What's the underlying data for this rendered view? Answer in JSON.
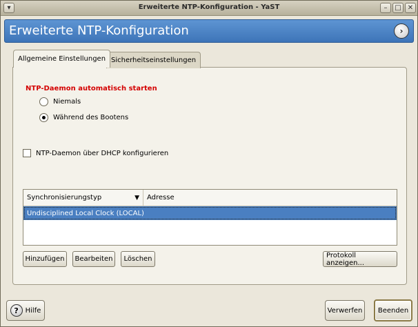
{
  "window": {
    "title": "Erweiterte NTP-Konfiguration - YaST",
    "controls": {
      "minimize": "–",
      "maximize": "□",
      "close": "✕"
    }
  },
  "header": {
    "title": "Erweiterte NTP-Konfiguration",
    "icon": "help-arrow-icon"
  },
  "tabs": [
    {
      "label": "Allgemeine Einstellungen",
      "active": true
    },
    {
      "label": "Sicherheitseinstellungen",
      "active": false
    }
  ],
  "start_section": {
    "label": "NTP-Daemon automatisch starten",
    "options": [
      {
        "label": "Niemals",
        "selected": false
      },
      {
        "label": "Während des Bootens",
        "selected": true
      }
    ]
  },
  "dhcp_checkbox": {
    "label": "NTP-Daemon über DHCP konfigurieren",
    "checked": false
  },
  "table": {
    "columns": [
      "Synchronisierungstyp",
      "Adresse"
    ],
    "sort_icon": "chevron-down-icon",
    "rows": [
      {
        "type": "Undisciplined Local Clock (LOCAL)",
        "address": "",
        "selected": true
      }
    ]
  },
  "table_buttons": {
    "add": "Hinzufügen",
    "edit": "Bearbeiten",
    "delete": "Löschen",
    "log": "Protokoll anzeigen..."
  },
  "footer": {
    "help": "Hilfe",
    "discard": "Verwerfen",
    "finish": "Beenden"
  },
  "colors": {
    "header": "#4a82c6",
    "selection": "#4a7fc1",
    "section_label": "#d40000"
  }
}
